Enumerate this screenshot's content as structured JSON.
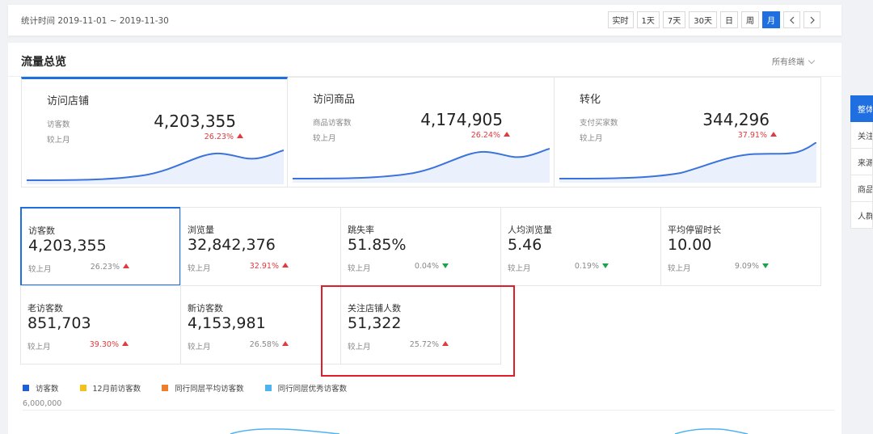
{
  "header": {
    "stats_time": "统计时间 2019-11-01 ~ 2019-11-30",
    "range_buttons": [
      "实时",
      "1天",
      "7天",
      "30天",
      "日",
      "周",
      "月"
    ],
    "active_range": "月"
  },
  "panel": {
    "title": "流量总览",
    "terminal_filter": "所有终端"
  },
  "overview_cards": [
    {
      "title": "访问店铺",
      "label": "访客数",
      "value": "4,203,355",
      "compare": "较上月",
      "pct": "26.23%",
      "trend": "up"
    },
    {
      "title": "访问商品",
      "label": "商品访客数",
      "value": "4,174,905",
      "compare": "较上月",
      "pct": "26.24%",
      "trend": "up"
    },
    {
      "title": "转化",
      "label": "支付买家数",
      "value": "344,296",
      "compare": "较上月",
      "pct": "37.91%",
      "trend": "up"
    }
  ],
  "metrics": [
    {
      "title": "访客数",
      "value": "4,203,355",
      "compare": "较上月",
      "pct": "26.23%",
      "trend": "up"
    },
    {
      "title": "浏览量",
      "value": "32,842,376",
      "compare": "较上月",
      "pct": "32.91%",
      "trend": "up"
    },
    {
      "title": "跳失率",
      "value": "51.85%",
      "compare": "较上月",
      "pct": "0.04%",
      "trend": "down"
    },
    {
      "title": "人均浏览量",
      "value": "5.46",
      "compare": "较上月",
      "pct": "0.19%",
      "trend": "down"
    },
    {
      "title": "平均停留时长",
      "value": "10.00",
      "compare": "较上月",
      "pct": "9.09%",
      "trend": "down"
    },
    {
      "title": "老访客数",
      "value": "851,703",
      "compare": "较上月",
      "pct": "39.30%",
      "trend": "up"
    },
    {
      "title": "新访客数",
      "value": "4,153,981",
      "compare": "较上月",
      "pct": "26.58%",
      "trend": "up"
    },
    {
      "title": "关注店铺人数",
      "value": "51,322",
      "compare": "较上月",
      "pct": "25.72%",
      "trend": "up"
    }
  ],
  "legend": [
    {
      "label": "访客数",
      "color": "#1f5fd6"
    },
    {
      "label": "12月前访客数",
      "color": "#f2c21b"
    },
    {
      "label": "同行同层平均访客数",
      "color": "#f07d2c"
    },
    {
      "label": "同行同层优秀访客数",
      "color": "#4fb3f0"
    }
  ],
  "chart_y_top": "6,000,000",
  "side_tabs": [
    "整体",
    "关注",
    "来源",
    "商品",
    "人群"
  ],
  "active_side_tab": "整体",
  "colors": {
    "accent": "#1f6fe0",
    "up": "#e0393e",
    "down": "#1aa34a",
    "highlight": "#e11d2a"
  }
}
